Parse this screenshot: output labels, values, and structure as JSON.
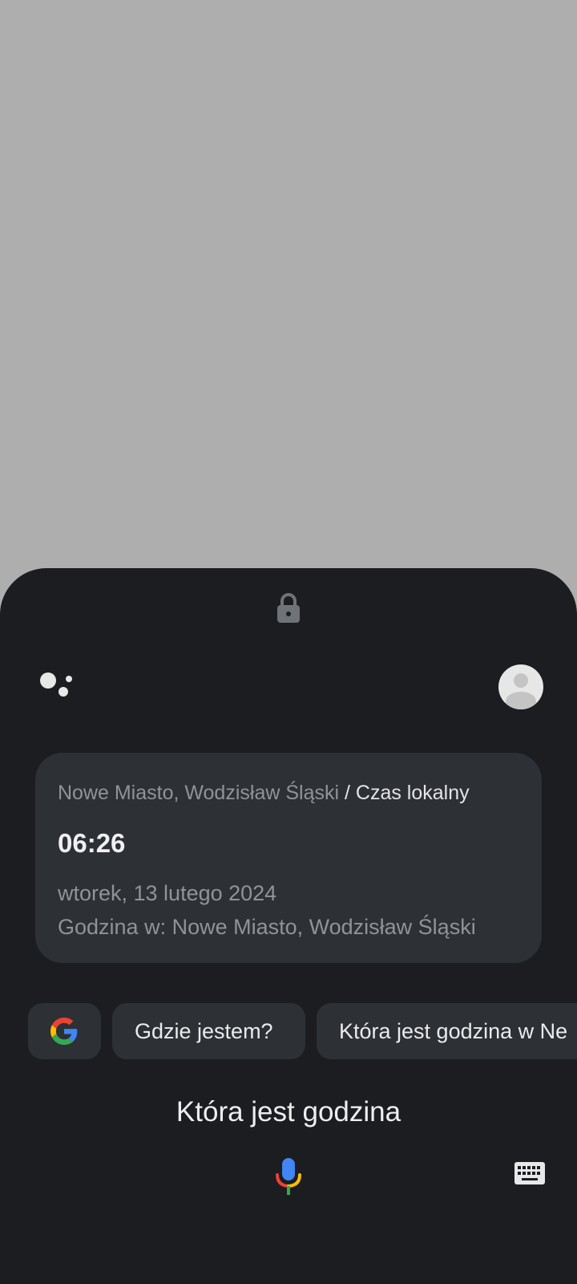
{
  "lock_screen": {
    "lock_icon": "lock-icon"
  },
  "assistant": {
    "logo_icon": "google-assistant-dots-icon",
    "avatar_icon": "account-avatar-icon"
  },
  "result_card": {
    "location": "Nowe Miasto, Wodzisław Śląski",
    "separator": " / ",
    "local_label": "Czas lokalny",
    "time": "06:26",
    "date": "wtorek, 13 lutego 2024",
    "place_line": "Godzina w: Nowe Miasto, Wodzisław Śląski"
  },
  "suggestions": {
    "google_icon": "google-g-icon",
    "items": [
      {
        "label": "Gdzie jestem?"
      },
      {
        "label": "Która jest godzina w Ne"
      }
    ]
  },
  "query": {
    "text": "Która jest godzina"
  },
  "input": {
    "mic_icon": "microphone-icon",
    "keyboard_icon": "keyboard-icon"
  },
  "colors": {
    "backdrop": "#aeaeae",
    "sheet": "#1b1d20",
    "card": "#2d3034",
    "google_blue": "#4285f4",
    "google_red": "#ea4335",
    "google_yellow": "#fbbc05",
    "google_green": "#34a853"
  }
}
